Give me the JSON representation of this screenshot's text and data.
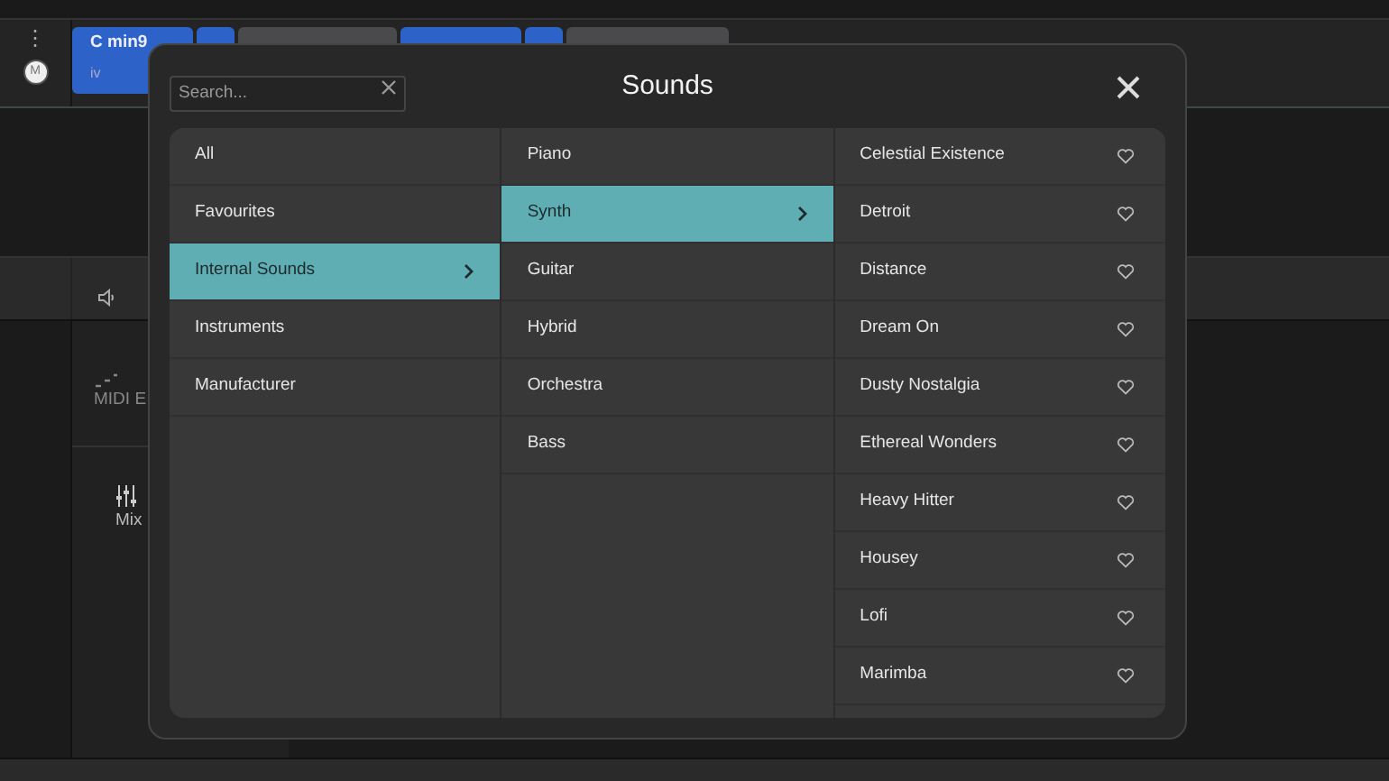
{
  "track": {
    "menu_glyph": "⋮",
    "mute": "M",
    "chords": [
      {
        "name": "C min9",
        "degree": "iv",
        "color": "#2d63c8"
      },
      {
        "color": "#2d63c8"
      },
      {
        "color": "#4a4a4c"
      },
      {
        "color": "#2d63c8"
      },
      {
        "color": "#2d63c8"
      },
      {
        "color": "#4a4a4c"
      }
    ]
  },
  "side_tools": [
    {
      "label": "MIDI E",
      "kind": "midi"
    },
    {
      "label": "Mix",
      "kind": "mixer"
    }
  ],
  "dialog": {
    "title": "Sounds",
    "search": {
      "placeholder": "Search..."
    },
    "categories": [
      {
        "label": "All",
        "selected": false
      },
      {
        "label": "Favourites",
        "selected": false
      },
      {
        "label": "Internal Sounds",
        "selected": true
      },
      {
        "label": "Instruments",
        "selected": false
      },
      {
        "label": "Manufacturer",
        "selected": false
      }
    ],
    "subcategories": [
      {
        "label": "Piano",
        "selected": false
      },
      {
        "label": "Synth",
        "selected": true
      },
      {
        "label": "Guitar",
        "selected": false
      },
      {
        "label": "Hybrid",
        "selected": false
      },
      {
        "label": "Orchestra",
        "selected": false
      },
      {
        "label": "Bass",
        "selected": false
      }
    ],
    "sounds": [
      {
        "label": "Celestial Existence",
        "favourite": false
      },
      {
        "label": "Detroit",
        "favourite": false
      },
      {
        "label": "Distance",
        "favourite": false
      },
      {
        "label": "Dream On",
        "favourite": false
      },
      {
        "label": "Dusty Nostalgia",
        "favourite": false
      },
      {
        "label": "Ethereal Wonders",
        "favourite": false
      },
      {
        "label": "Heavy Hitter",
        "favourite": false
      },
      {
        "label": "Housey",
        "favourite": false
      },
      {
        "label": "Lofi",
        "favourite": false
      },
      {
        "label": "Marimba",
        "favourite": false
      }
    ]
  }
}
